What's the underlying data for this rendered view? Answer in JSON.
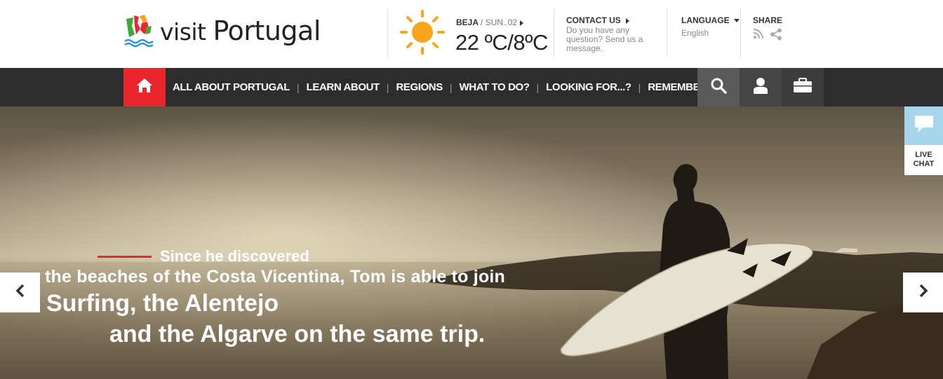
{
  "brand": {
    "logo_word1": "visit",
    "logo_word2": "Portugal"
  },
  "weather": {
    "location": "BEJA",
    "date": "/ SUN..02",
    "temperature": "22 ºC/8ºC",
    "icon": "sun-icon"
  },
  "contact": {
    "label": "CONTACT US",
    "text": "Do you have any question? Send us a message."
  },
  "language": {
    "label": "LANGUAGE",
    "value": "English"
  },
  "share": {
    "label": "SHARE",
    "icons": [
      "rss-icon",
      "share-icon"
    ]
  },
  "nav": {
    "home_icon": "home-icon",
    "items": [
      {
        "label": "ALL ABOUT PORTUGAL"
      },
      {
        "label": "LEARN ABOUT"
      },
      {
        "label": "REGIONS"
      },
      {
        "label": "WHAT TO DO?"
      },
      {
        "label": "LOOKING FOR...?"
      },
      {
        "label": "REMEMBER & SHARE"
      }
    ],
    "separator": "|",
    "buttons": [
      "search-icon",
      "user-icon",
      "briefcase-icon"
    ]
  },
  "hero": {
    "line1": "Since he discovered",
    "line2": "the beaches of the Costa Vicentina, Tom is able to join",
    "line3": "Surfing, the Alentejo",
    "line4": "and the Algarve on the same trip."
  },
  "live_chat": {
    "line1": "LIVE",
    "line2": "CHAT"
  },
  "colors": {
    "accent_red": "#e8262c",
    "nav_bg": "#2d2d2d",
    "sun": "#f7a51c",
    "chat_blue": "#a5d6ea"
  }
}
